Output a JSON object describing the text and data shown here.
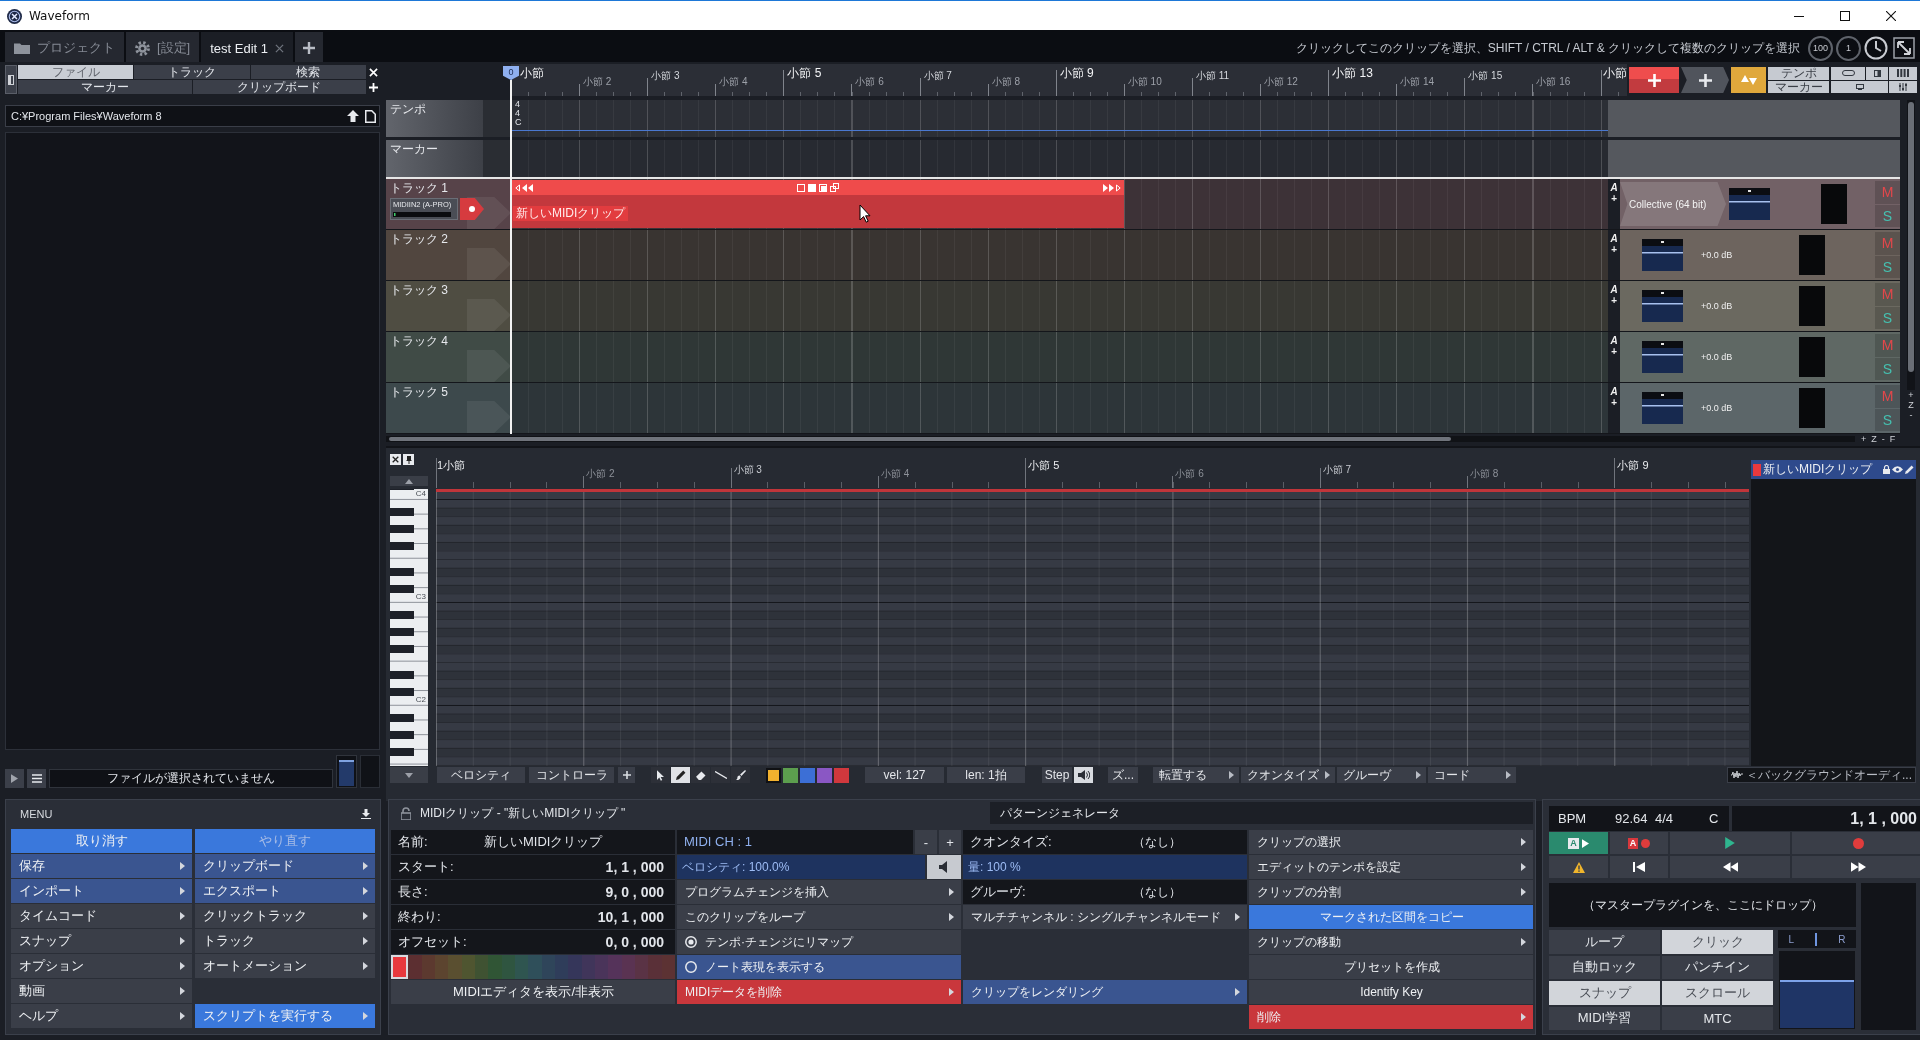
{
  "window": {
    "title": "Waveform"
  },
  "tabs": [
    {
      "label": "プロジェクト",
      "kind": "folder",
      "selected": false,
      "closable": false
    },
    {
      "label": "[設定]",
      "kind": "settings",
      "selected": false,
      "closable": false
    },
    {
      "label": "test Edit 1",
      "kind": "edit",
      "selected": true,
      "closable": true
    }
  ],
  "toolbar": {
    "hint": "クリックしてこのクリップを選択、SHIFT / CTRL / ALT & クリックして複数のクリップを選択",
    "dials": [
      "100",
      "1"
    ]
  },
  "browser": {
    "tab_rows": [
      [
        {
          "label": "ファイル",
          "selected": true
        },
        {
          "label": "トラック",
          "selected": false
        },
        {
          "label": "検索",
          "selected": false
        }
      ],
      [
        {
          "label": "マーカー",
          "selected": false
        },
        {
          "label": "クリップボード",
          "selected": false
        }
      ]
    ],
    "path": "C:¥Program Files¥Waveform 8",
    "status": "ファイルが選択されていません",
    "preview_volume": {
      "level": 0.9
    }
  },
  "arranger": {
    "playhead": "0",
    "bars": [
      {
        "label": "小節",
        "kind": "major"
      },
      {
        "label": "小節 2",
        "kind": "minor"
      },
      {
        "label": "小節 3",
        "kind": "mid"
      },
      {
        "label": "小節 4",
        "kind": "minor"
      },
      {
        "label": "小節 5",
        "kind": "major"
      },
      {
        "label": "小節 6",
        "kind": "minor"
      },
      {
        "label": "小節 7",
        "kind": "mid"
      },
      {
        "label": "小節 8",
        "kind": "minor"
      },
      {
        "label": "小節 9",
        "kind": "major"
      },
      {
        "label": "小節 10",
        "kind": "minor"
      },
      {
        "label": "小節 11",
        "kind": "mid"
      },
      {
        "label": "小節 12",
        "kind": "minor"
      },
      {
        "label": "小節 13",
        "kind": "major"
      },
      {
        "label": "小節 14",
        "kind": "minor"
      },
      {
        "label": "小節 15",
        "kind": "mid"
      },
      {
        "label": "小節 16",
        "kind": "minor"
      },
      {
        "label": "小節",
        "kind": "major"
      }
    ],
    "tempo_button": "テンポ",
    "marker_button": "マーカー",
    "tempo_track": {
      "name": "テンポ",
      "values": [
        "4",
        "4",
        "C"
      ]
    },
    "marker_track": {
      "name": "マーカー"
    },
    "tracks": [
      {
        "name": "トラック 1",
        "color": "#574349",
        "input": "MIDIIN2 (A-PRO)",
        "armed": true,
        "auto": "A",
        "add": "+",
        "clips": [
          {
            "name": "新しいMIDIクリップ",
            "selected": true
          }
        ],
        "plugin": "Collective (64 bit)",
        "mute": "M",
        "solo": "S"
      },
      {
        "name": "トラック 2",
        "color": "#51463f",
        "armed": false,
        "auto": "A",
        "add": "+",
        "volume": "+0.0 dB",
        "mute": "M",
        "solo": "S"
      },
      {
        "name": "トラック 3",
        "color": "#4f4d42",
        "armed": false,
        "auto": "A",
        "add": "+",
        "volume": "+0.0 dB",
        "mute": "M",
        "solo": "S"
      },
      {
        "name": "トラック 4",
        "color": "#404b46",
        "armed": false,
        "auto": "A",
        "add": "+",
        "volume": "+0.0 dB",
        "mute": "M",
        "solo": "S"
      },
      {
        "name": "トラック 5",
        "color": "#3d494c",
        "armed": false,
        "auto": "A",
        "add": "+",
        "volume": "+0.0 dB",
        "mute": "M",
        "solo": "S"
      }
    ],
    "vertical_zoom": [
      "+",
      "Z",
      "-"
    ],
    "horizontal_zoom": [
      "+",
      "Z",
      "-",
      "F"
    ]
  },
  "piano_roll": {
    "bars": [
      {
        "label": "1小節",
        "kind": "major"
      },
      {
        "label": "小節 2",
        "kind": "minor"
      },
      {
        "label": "小節 3",
        "kind": "mid"
      },
      {
        "label": "小節 4",
        "kind": "minor"
      },
      {
        "label": "小節 5",
        "kind": "major"
      },
      {
        "label": "小節 6",
        "kind": "minor"
      },
      {
        "label": "小節 7",
        "kind": "mid"
      },
      {
        "label": "小節 8",
        "kind": "minor"
      },
      {
        "label": "小節 9",
        "kind": "major"
      }
    ],
    "keys": [
      "C4",
      "C3",
      "C2"
    ],
    "toolbar": {
      "velocity": "ベロシティ",
      "controller": "コントローラ",
      "tools": [
        {
          "kind": "pointer",
          "selected": false
        },
        {
          "kind": "pencil",
          "selected": true
        },
        {
          "kind": "eraser",
          "selected": false
        },
        {
          "kind": "line",
          "selected": false
        },
        {
          "kind": "brush",
          "selected": false
        }
      ],
      "colors": [
        {
          "color": "#f2b12e",
          "selected": true
        },
        {
          "color": "#5c9e4e",
          "selected": false
        },
        {
          "color": "#3c6fd6",
          "selected": false
        },
        {
          "color": "#8a57c4",
          "selected": false
        },
        {
          "color": "#d0383d",
          "selected": false
        }
      ],
      "velocity_value": "vel: 127",
      "length": "len: 1拍",
      "step": "Step",
      "zoom": "ズ...",
      "menus": [
        "転置する",
        "クオンタイズ",
        "グルーヴ",
        "コード"
      ]
    },
    "clips": [
      {
        "name": "新しいMIDIクリップ",
        "color": "#e8393e",
        "selected": true
      }
    ],
    "background_audio": "＜バックグラウンドオーディ..."
  },
  "menu": {
    "title": "MENU",
    "columns": [
      [
        {
          "label": "取り消す",
          "color": "#3a78dc",
          "submenu": false,
          "disabled": false
        },
        {
          "label": "保存",
          "color": "#3a5590",
          "submenu": true,
          "disabled": false
        },
        {
          "label": "インポート",
          "color": "#3a5590",
          "submenu": true,
          "disabled": false
        },
        {
          "label": "タイムコード",
          "color": "#3a3e48",
          "submenu": true,
          "disabled": false
        },
        {
          "label": "スナップ",
          "color": "#3a3e48",
          "submenu": true,
          "disabled": false
        },
        {
          "label": "オプション",
          "color": "#3a3e48",
          "submenu": true,
          "disabled": false
        },
        {
          "label": "動画",
          "color": "#3a3e48",
          "submenu": true,
          "disabled": false
        },
        {
          "label": "ヘルプ",
          "color": "#3a3e48",
          "submenu": true,
          "disabled": false
        }
      ],
      [
        {
          "label": "やり直す",
          "color": "#3a78dc",
          "submenu": false,
          "disabled": true
        },
        {
          "label": "クリップボード",
          "color": "#3a5590",
          "submenu": true,
          "disabled": false
        },
        {
          "label": "エクスポート",
          "color": "#3a5590",
          "submenu": true,
          "disabled": false
        },
        {
          "label": "クリックトラック",
          "color": "#3a3e48",
          "submenu": true,
          "disabled": false
        },
        {
          "label": "トラック",
          "color": "#3a3e48",
          "submenu": true,
          "disabled": false
        },
        {
          "label": "オートメーション",
          "color": "#3a3e48",
          "submenu": true,
          "disabled": false
        },
        {
          "label": "スクリプトを実行する",
          "color": "#3a78dc",
          "submenu": true,
          "disabled": false
        }
      ]
    ]
  },
  "clip_panel": {
    "tabs": [
      {
        "label": "MIDIクリップ - \"新しいMIDIクリップ \"",
        "selected": true
      },
      {
        "label": "パターンジェネレータ",
        "selected": false
      }
    ],
    "properties": [
      {
        "label": "名前:",
        "value": "新しいMIDIクリップ",
        "kind": "text"
      },
      {
        "label": "スタート:",
        "value": "1, 1 , 000",
        "kind": "time"
      },
      {
        "label": "長さ:",
        "value": "9, 0 , 000",
        "kind": "time"
      },
      {
        "label": "終わり:",
        "value": "10, 1 , 000",
        "kind": "time"
      },
      {
        "label": "オフセット:",
        "value": "0, 0 , 000",
        "kind": "time"
      }
    ],
    "swatches": [
      {
        "color": "#e8393e",
        "selected": true
      },
      {
        "color": "#5c2f31",
        "selected": false
      },
      {
        "color": "#5c392f",
        "selected": false
      },
      {
        "color": "#5c442f",
        "selected": false
      },
      {
        "color": "#5a4f30",
        "selected": false
      },
      {
        "color": "#4f5530",
        "selected": false
      },
      {
        "color": "#3f5232",
        "selected": false
      },
      {
        "color": "#305535",
        "selected": false
      },
      {
        "color": "#2f5540",
        "selected": false
      },
      {
        "color": "#2f5550",
        "selected": false
      },
      {
        "color": "#2f4f5a",
        "selected": false
      },
      {
        "color": "#2f455a",
        "selected": false
      },
      {
        "color": "#2f3d5a",
        "selected": false
      },
      {
        "color": "#35365a",
        "selected": false
      },
      {
        "color": "#40355a",
        "selected": false
      },
      {
        "color": "#4a345a",
        "selected": false
      },
      {
        "color": "#55335a",
        "selected": false
      },
      {
        "color": "#5a3352",
        "selected": false
      },
      {
        "color": "#5a3345",
        "selected": false
      },
      {
        "color": "#5a3038",
        "selected": false
      },
      {
        "color": "#5c3233",
        "selected": false
      }
    ],
    "editor_button": "MIDIエディタを表示/非表示",
    "column_2": [
      {
        "kind": "stepper",
        "label": "MIDI CH : 1",
        "minus": "-",
        "plus": "+"
      },
      {
        "kind": "slider",
        "label": "ベロシティ: 100.0%",
        "level": 1,
        "mute_toggle": true
      },
      {
        "kind": "menu",
        "label": "プログラムチェンジを挿入",
        "color": "#3a3e48",
        "submenu": true
      },
      {
        "kind": "menu",
        "label": "このクリップをループ",
        "color": "#3a3e48",
        "submenu": true
      },
      {
        "kind": "radio",
        "label": "テンポ·チェンジにリマップ",
        "checked": true,
        "color": "#3a3e48"
      },
      {
        "kind": "radio",
        "label": "ノート表現を表示する",
        "checked": false,
        "color": "#3a5590"
      },
      {
        "kind": "menu",
        "label": "MIDIデータを削除",
        "color": "#c9373c",
        "submenu": true
      }
    ],
    "column_3": [
      {
        "kind": "choice",
        "label": "クオンタイズ:",
        "value": "（なし）"
      },
      {
        "kind": "slider",
        "label": "量: 100 %",
        "level": 1,
        "mute_toggle": false
      },
      {
        "kind": "choice",
        "label": "グルーヴ:",
        "value": "（なし）"
      },
      {
        "kind": "menu",
        "label": "マルチチャンネル : シングルチャンネルモード",
        "color": "#3a3e48",
        "submenu": true
      },
      {
        "kind": "menu",
        "label": "クリップをレンダリング",
        "color": "#3a5590",
        "submenu": true
      }
    ],
    "column_4": [
      {
        "kind": "menu",
        "label": "クリップの選択",
        "color": "#3a3e48",
        "submenu": true
      },
      {
        "kind": "menu",
        "label": "エディットのテンポを設定",
        "color": "#3a3e48",
        "submenu": true
      },
      {
        "kind": "menu",
        "label": "クリップの分割",
        "color": "#3a3e48",
        "submenu": true
      },
      {
        "kind": "menu",
        "label": "マークされた区間をコピー",
        "color": "#3a78dc",
        "submenu": false
      },
      {
        "kind": "menu",
        "label": "クリップの移動",
        "color": "#3a3e48",
        "submenu": true
      },
      {
        "kind": "menu",
        "label": "プリセットを作成",
        "color": "#3a3e48",
        "submenu": false
      },
      {
        "kind": "menu",
        "label": "Identify Key",
        "color": "#3a3e48",
        "submenu": false
      },
      {
        "kind": "menu",
        "label": "削除",
        "color": "#c9373c",
        "submenu": true
      }
    ]
  },
  "transport": {
    "bpm_label": "BPM",
    "tempo": "92.64",
    "time_signature": "4/4",
    "key": "C",
    "position": "1, 1 , 000",
    "buttons": [
      {
        "kind": "auto-play",
        "badge": "A",
        "on": true
      },
      {
        "kind": "auto-record",
        "badge": "A",
        "on": false
      },
      {
        "kind": "play",
        "on": false
      },
      {
        "kind": "record",
        "on": false
      },
      {
        "kind": "warning",
        "on": false
      },
      {
        "kind": "to-start",
        "on": false
      },
      {
        "kind": "rewind",
        "on": false
      },
      {
        "kind": "fast-forward",
        "on": false
      }
    ],
    "drop_hint": "（マスタープラグインを、ここにドロップ）",
    "toggles": [
      {
        "label": "ループ",
        "on": false
      },
      {
        "label": "クリック",
        "on": true
      },
      {
        "label": "自動ロック",
        "on": false
      },
      {
        "label": "パンチイン",
        "on": false
      },
      {
        "label": "スナップ",
        "on": true
      },
      {
        "label": "スクロール",
        "on": true
      },
      {
        "label": "MIDI学習",
        "on": false
      },
      {
        "label": "MTC",
        "on": false
      }
    ],
    "master": {
      "left": "L",
      "right": "R",
      "level": 0.62
    }
  }
}
